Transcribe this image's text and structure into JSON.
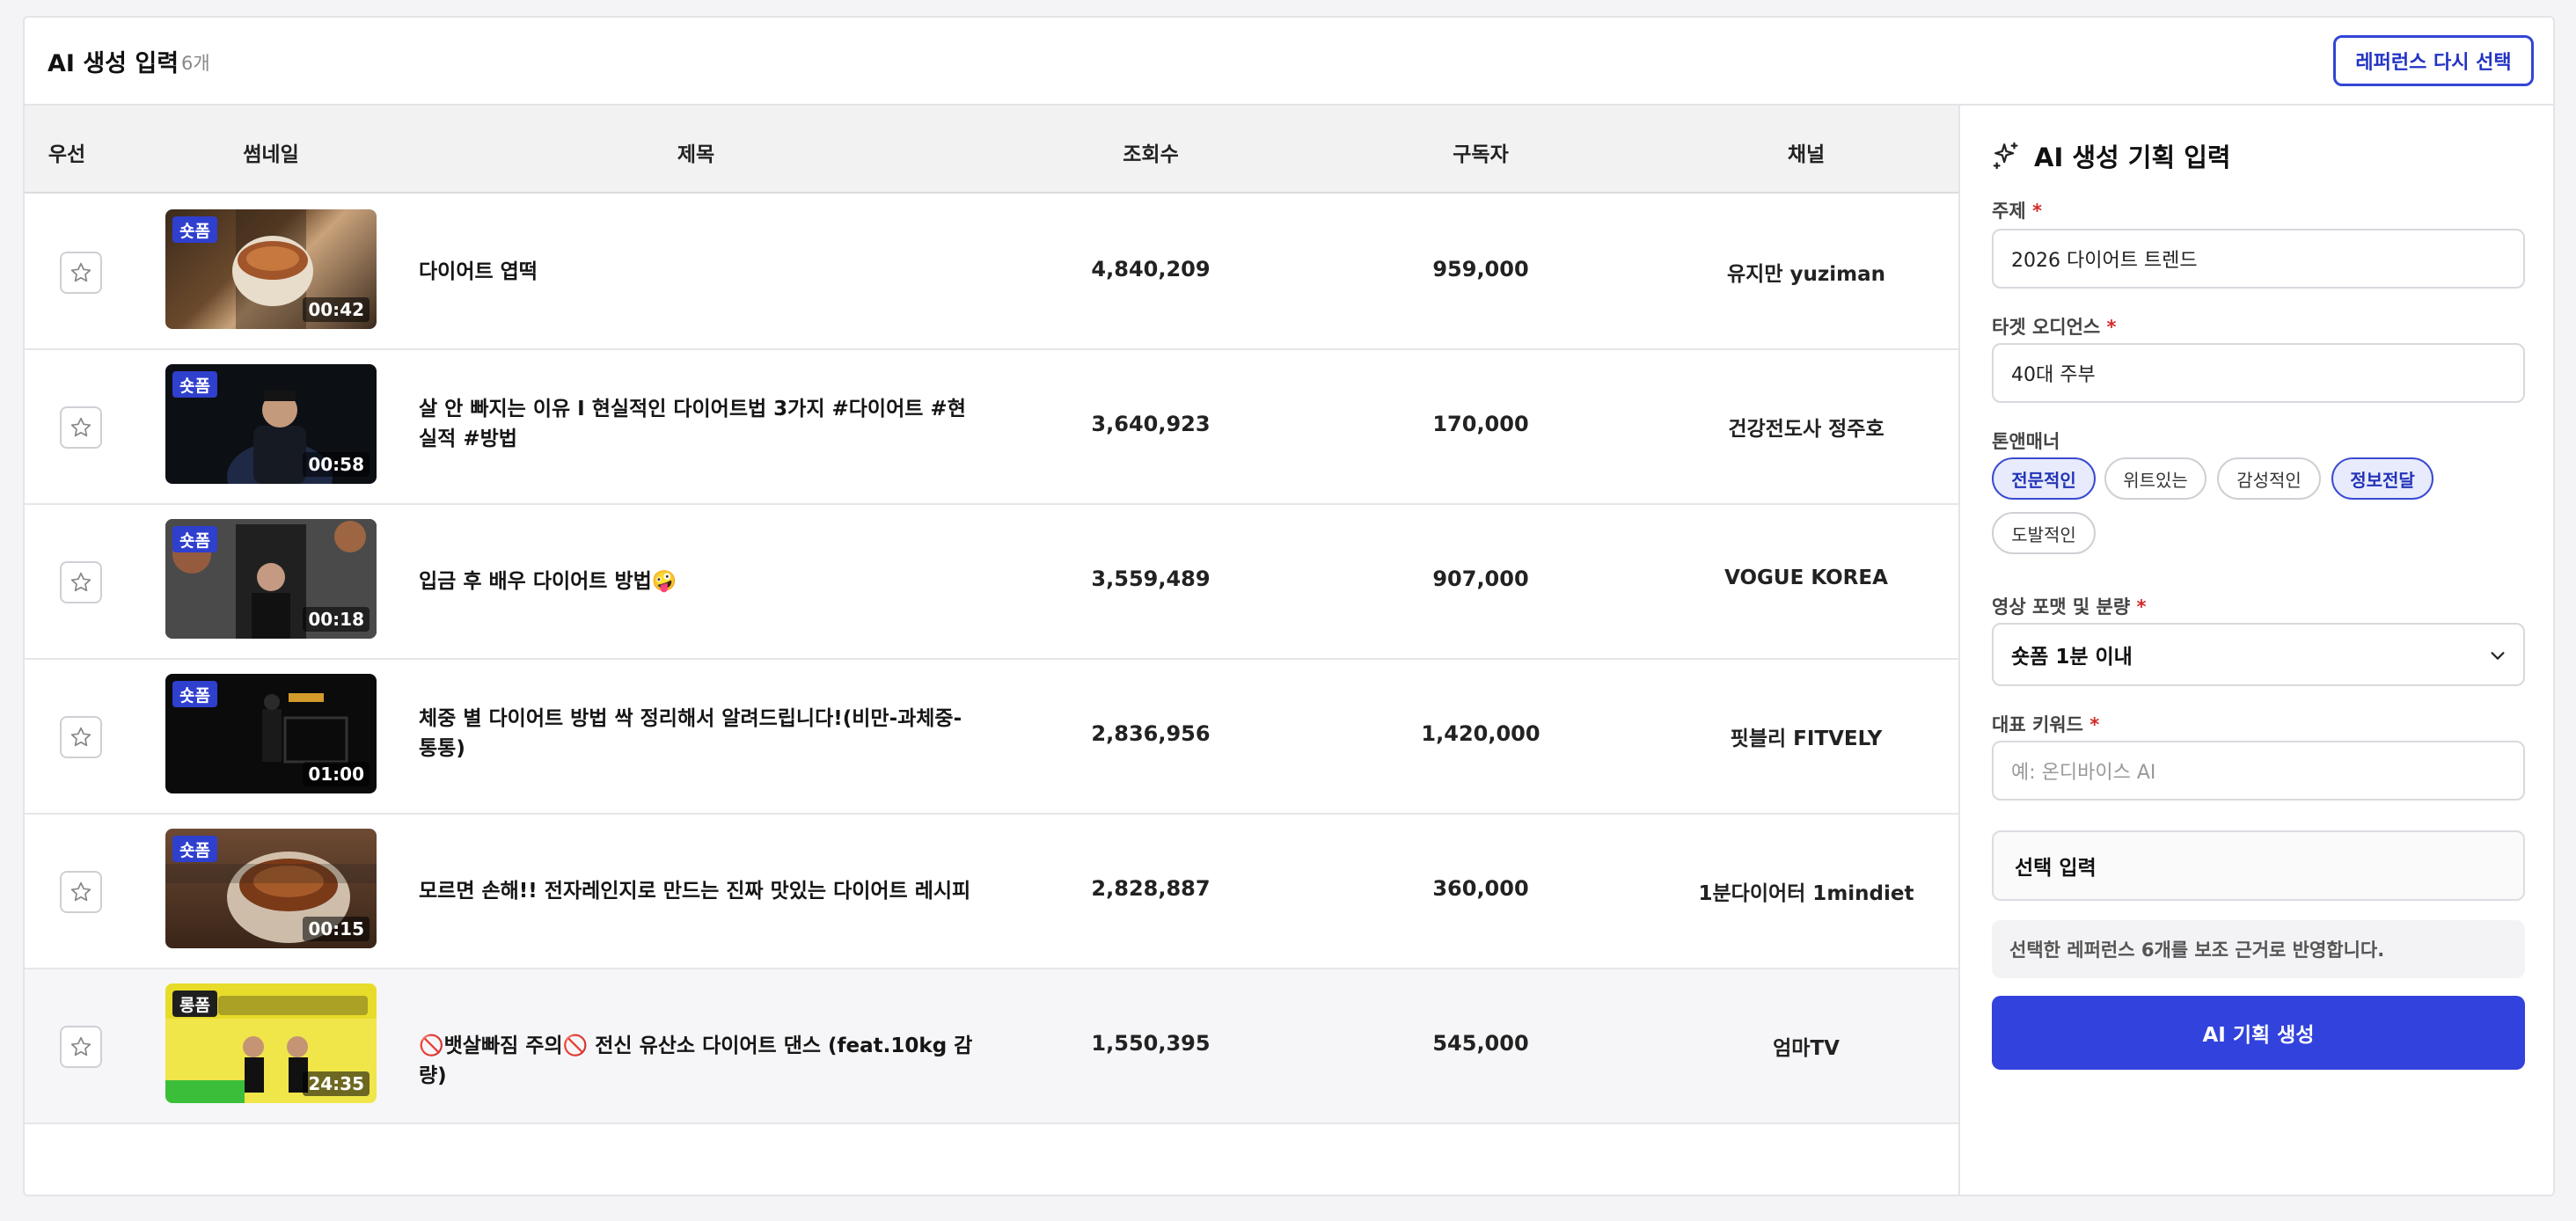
{
  "header": {
    "title": "AI 생성 입력",
    "count": "6개",
    "reselect_label": "레퍼런스 다시 선택"
  },
  "table": {
    "columns": [
      "우선",
      "썸네일",
      "제목",
      "조회수",
      "구독자",
      "채널"
    ],
    "rows": [
      {
        "badge": "숏폼",
        "duration": "00:42",
        "title": "다이어트 엽떡",
        "views": "4,840,209",
        "subscribers": "959,000",
        "channel": "유지만 yuziman"
      },
      {
        "badge": "숏폼",
        "duration": "00:58",
        "title": "살 안 빠지는 이유 I 현실적인 다이어트법 3가지 #다이어트 #현실적 #방법",
        "views": "3,640,923",
        "subscribers": "170,000",
        "channel": "건강전도사 정주호"
      },
      {
        "badge": "숏폼",
        "duration": "00:18",
        "title": "입금 후 배우 다이어트 방법🤪",
        "views": "3,559,489",
        "subscribers": "907,000",
        "channel": "VOGUE KOREA"
      },
      {
        "badge": "숏폼",
        "duration": "01:00",
        "title": "체중 별 다이어트 방법 싹 정리해서 알려드립니다!(비만-과체중-통통)",
        "views": "2,836,956",
        "subscribers": "1,420,000",
        "channel": "핏블리 FITVELY"
      },
      {
        "badge": "숏폼",
        "duration": "00:15",
        "title": "모르면 손해!! 전자레인지로 만드는 진짜 맛있는 다이어트 레시피",
        "views": "2,828,887",
        "subscribers": "360,000",
        "channel": "1분다이어터 1mindiet"
      },
      {
        "badge": "롱폼",
        "duration": "24:35",
        "title": "🚫뱃살빠짐 주의🚫 전신 유산소 다이어트 댄스 (feat.10kg 감량)",
        "views": "1,550,395",
        "subscribers": "545,000",
        "channel": "엄마TV"
      }
    ]
  },
  "panel": {
    "title": "AI 생성 기획 입력",
    "topic_label": "주제",
    "topic_value": "2026 다이어트 트렌드",
    "audience_label": "타겟 오디언스",
    "audience_value": "40대 주부",
    "tone_label": "톤앤매너",
    "tones": [
      {
        "label": "전문적인",
        "active": true
      },
      {
        "label": "위트있는",
        "active": false
      },
      {
        "label": "감성적인",
        "active": false
      },
      {
        "label": "정보전달",
        "active": true
      },
      {
        "label": "도발적인",
        "active": false
      }
    ],
    "format_label": "영상 포맷 및 분량",
    "format_value": "숏폼 1분 이내",
    "keyword_label": "대표 키워드",
    "keyword_placeholder": "예: 온디바이스 AI",
    "optional_label": "선택 입력",
    "note": "선택한 레퍼런스 6개를 보조 근거로 반영합니다.",
    "generate_label": "AI 기획 생성",
    "required_mark": "*"
  },
  "colors": {
    "accent": "#3242dc",
    "required": "#d42a2a"
  }
}
